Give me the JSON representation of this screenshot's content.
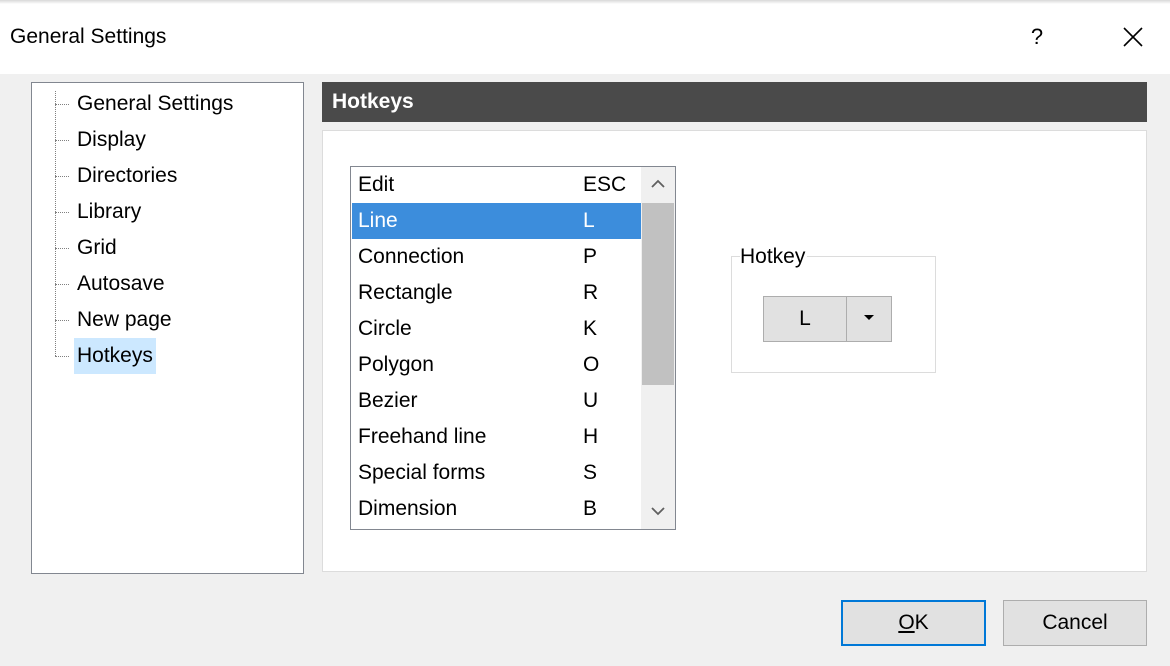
{
  "window": {
    "title": "General Settings",
    "help_label": "?",
    "close_icon": "close-icon"
  },
  "tree": {
    "items": [
      {
        "label": "General Settings",
        "selected": false
      },
      {
        "label": "Display",
        "selected": false
      },
      {
        "label": "Directories",
        "selected": false
      },
      {
        "label": "Library",
        "selected": false
      },
      {
        "label": "Grid",
        "selected": false
      },
      {
        "label": "Autosave",
        "selected": false
      },
      {
        "label": "New page",
        "selected": false
      },
      {
        "label": "Hotkeys",
        "selected": true
      }
    ]
  },
  "section": {
    "title": "Hotkeys"
  },
  "hotkey_list": {
    "rows": [
      {
        "name": "Edit",
        "key": "ESC",
        "selected": false
      },
      {
        "name": "Line",
        "key": "L",
        "selected": true
      },
      {
        "name": "Connection",
        "key": "P",
        "selected": false
      },
      {
        "name": "Rectangle",
        "key": "R",
        "selected": false
      },
      {
        "name": "Circle",
        "key": "K",
        "selected": false
      },
      {
        "name": "Polygon",
        "key": "O",
        "selected": false
      },
      {
        "name": "Bezier",
        "key": "U",
        "selected": false
      },
      {
        "name": "Freehand line",
        "key": "H",
        "selected": false
      },
      {
        "name": "Special forms",
        "key": "S",
        "selected": false
      },
      {
        "name": "Dimension",
        "key": "B",
        "selected": false
      }
    ]
  },
  "hotkey_group": {
    "label": "Hotkey",
    "selected_value": "L"
  },
  "buttons": {
    "ok_label": "OK",
    "cancel_label": "Cancel"
  },
  "colors": {
    "selection": "#3c8ddc",
    "tree_selection": "#cce8ff",
    "header_bg": "#4a4a4a",
    "accent": "#0078d7"
  }
}
